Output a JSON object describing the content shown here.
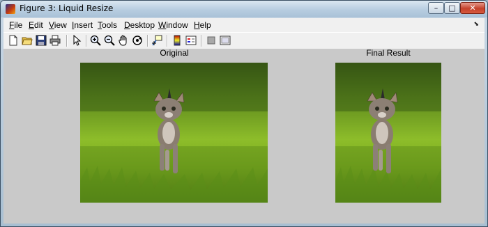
{
  "window": {
    "title": "Figure 3: Liquid Resize",
    "controls": {
      "minimize": "–",
      "maximize": "□",
      "close": "✕"
    }
  },
  "menubar": {
    "items": [
      {
        "label": "File",
        "accel": "F"
      },
      {
        "label": "Edit",
        "accel": "E"
      },
      {
        "label": "View",
        "accel": "V"
      },
      {
        "label": "Insert",
        "accel": "I"
      },
      {
        "label": "Tools",
        "accel": "T"
      },
      {
        "label": "Desktop",
        "accel": "D"
      },
      {
        "label": "Window",
        "accel": "W"
      },
      {
        "label": "Help",
        "accel": "H"
      }
    ]
  },
  "toolbar": {
    "icons": [
      "new-figure-icon",
      "open-file-icon",
      "save-icon",
      "print-icon",
      "edit-plot-arrow-icon",
      "zoom-in-icon",
      "zoom-out-icon",
      "pan-hand-icon",
      "rotate-3d-icon",
      "data-cursor-icon",
      "colorbar-icon",
      "legend-icon",
      "hide-plot-tools-icon",
      "show-plot-tools-icon"
    ]
  },
  "figure": {
    "panels": [
      {
        "title": "Original"
      },
      {
        "title": "Final Result"
      }
    ]
  }
}
